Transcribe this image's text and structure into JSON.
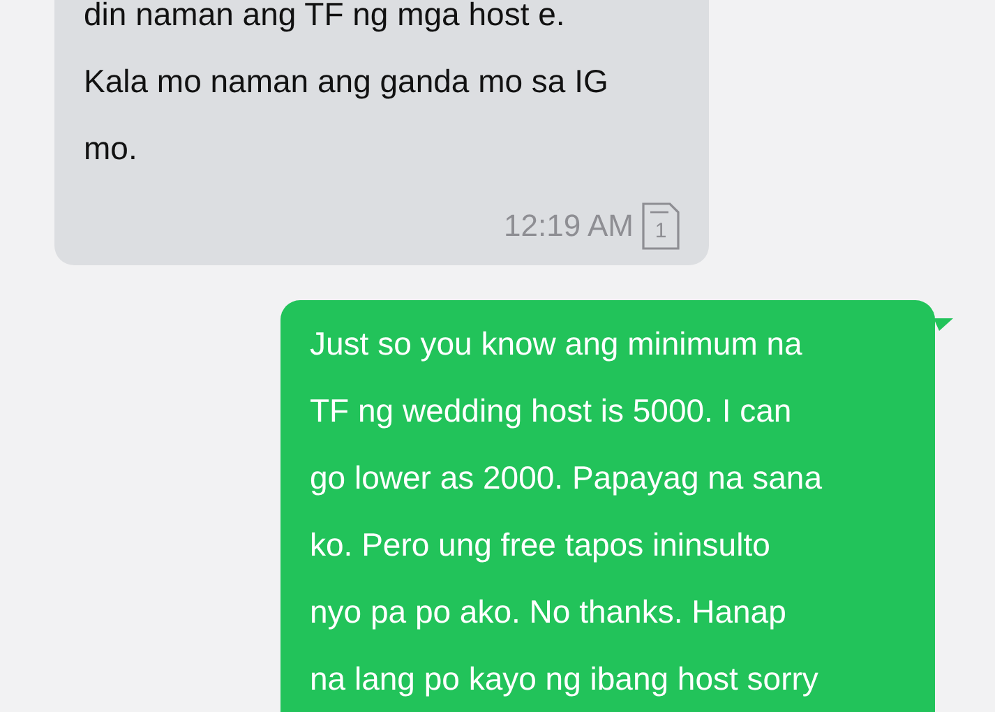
{
  "messages": [
    {
      "kind": "received",
      "lines": [
        "din naman ang TF ng mga host e.",
        "Kala mo naman ang ganda mo sa IG",
        "mo."
      ],
      "time": "12:19 AM",
      "sim_slot": "1"
    },
    {
      "kind": "sent",
      "lines": [
        "Just so you know ang minimum na",
        "TF ng wedding host is 5000. I can",
        "go lower as 2000. Papayag na sana",
        "ko. Pero ung free tapos ininsulto",
        "nyo pa po ako. No thanks. Hanap",
        "na lang po kayo ng ibang host sorry"
      ]
    }
  ]
}
